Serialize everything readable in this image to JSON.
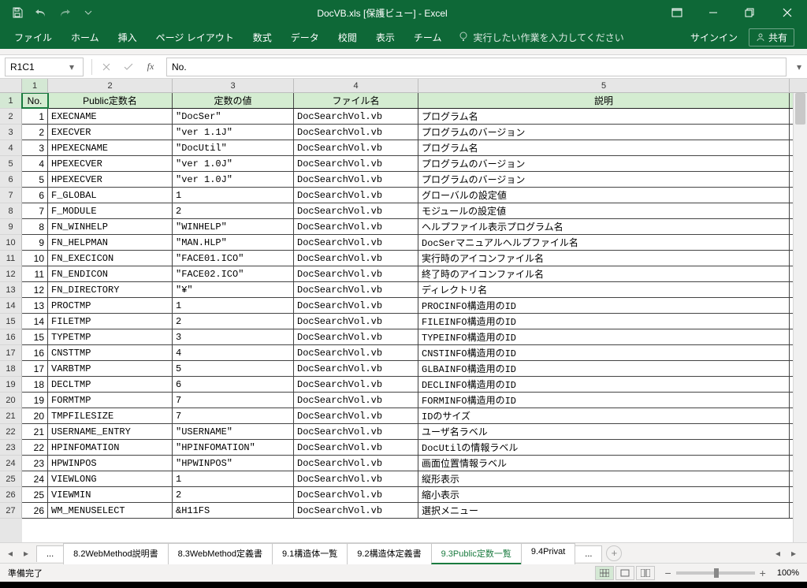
{
  "title": "DocVB.xls  [保護ビュー] - Excel",
  "qat": {
    "save": "保存",
    "undo": "元に戻す",
    "redo": "やり直し",
    "customize": "クイックアクセスツールバーのカスタマイズ"
  },
  "win": {
    "ribbon_opts": "リボン表示オプション",
    "min": "最小化",
    "restore": "元に戻す",
    "close": "閉じる"
  },
  "tabs": [
    "ファイル",
    "ホーム",
    "挿入",
    "ページ レイアウト",
    "数式",
    "データ",
    "校閲",
    "表示",
    "チーム"
  ],
  "tell_me": "実行したい作業を入力してください",
  "signin": "サインイン",
  "share": "共有",
  "name_box": "R1C1",
  "formula_value": "No.",
  "col_numbers": [
    "1",
    "2",
    "3",
    "4",
    "5"
  ],
  "headers": [
    "No.",
    "Public定数名",
    "定数の値",
    "ファイル名",
    "説明"
  ],
  "rows": [
    {
      "no": "1",
      "name": "EXECNAME",
      "val": "\"DocSer\"",
      "file": "DocSearchVol.vb",
      "desc": "プログラム名"
    },
    {
      "no": "2",
      "name": "EXECVER",
      "val": "\"ver 1.1J\"",
      "file": "DocSearchVol.vb",
      "desc": "プログラムのバージョン"
    },
    {
      "no": "3",
      "name": "HPEXECNAME",
      "val": "\"DocUtil\"",
      "file": "DocSearchVol.vb",
      "desc": "プログラム名"
    },
    {
      "no": "4",
      "name": "HPEXECVER",
      "val": "\"ver 1.0J\"",
      "file": "DocSearchVol.vb",
      "desc": "プログラムのバージョン"
    },
    {
      "no": "5",
      "name": "HPEXECVER",
      "val": "\"ver 1.0J\"",
      "file": "DocSearchVol.vb",
      "desc": "プログラムのバージョン"
    },
    {
      "no": "6",
      "name": "F_GLOBAL",
      "val": "1",
      "file": "DocSearchVol.vb",
      "desc": "グローバルの設定値"
    },
    {
      "no": "7",
      "name": "F_MODULE",
      "val": "2",
      "file": "DocSearchVol.vb",
      "desc": "モジュールの設定値"
    },
    {
      "no": "8",
      "name": "FN_WINHELP",
      "val": "\"WINHELP\"",
      "file": "DocSearchVol.vb",
      "desc": "ヘルプファイル表示プログラム名"
    },
    {
      "no": "9",
      "name": "FN_HELPMAN",
      "val": "\"MAN.HLP\"",
      "file": "DocSearchVol.vb",
      "desc": "DocSerマニュアルヘルプファイル名"
    },
    {
      "no": "10",
      "name": "FN_EXECICON",
      "val": "\"FACE01.ICO\"",
      "file": "DocSearchVol.vb",
      "desc": "実行時のアイコンファイル名"
    },
    {
      "no": "11",
      "name": "FN_ENDICON",
      "val": "\"FACE02.ICO\"",
      "file": "DocSearchVol.vb",
      "desc": "終了時のアイコンファイル名"
    },
    {
      "no": "12",
      "name": "FN_DIRECTORY",
      "val": "\"¥\"",
      "file": "DocSearchVol.vb",
      "desc": "ディレクトリ名"
    },
    {
      "no": "13",
      "name": "PROCTMP",
      "val": "1",
      "file": "DocSearchVol.vb",
      "desc": "PROCINFO構造用のID"
    },
    {
      "no": "14",
      "name": "FILETMP",
      "val": "2",
      "file": "DocSearchVol.vb",
      "desc": "FILEINFO構造用のID"
    },
    {
      "no": "15",
      "name": "TYPETMP",
      "val": "3",
      "file": "DocSearchVol.vb",
      "desc": "TYPEINFO構造用のID"
    },
    {
      "no": "16",
      "name": "CNSTTMP",
      "val": "4",
      "file": "DocSearchVol.vb",
      "desc": "CNSTINFO構造用のID"
    },
    {
      "no": "17",
      "name": "VARBTMP",
      "val": "5",
      "file": "DocSearchVol.vb",
      "desc": "GLBAINFO構造用のID"
    },
    {
      "no": "18",
      "name": "DECLTMP",
      "val": "6",
      "file": "DocSearchVol.vb",
      "desc": "DECLINFO構造用のID"
    },
    {
      "no": "19",
      "name": "FORMTMP",
      "val": "7",
      "file": "DocSearchVol.vb",
      "desc": "FORMINFO構造用のID"
    },
    {
      "no": "20",
      "name": "TMPFILESIZE",
      "val": "7",
      "file": "DocSearchVol.vb",
      "desc": "IDのサイズ"
    },
    {
      "no": "21",
      "name": "USERNAME_ENTRY",
      "val": "\"USERNAME\"",
      "file": "DocSearchVol.vb",
      "desc": "ユーザ名ラベル"
    },
    {
      "no": "22",
      "name": "HPINFOMATION",
      "val": "\"HPINFOMATION\"",
      "file": "DocSearchVol.vb",
      "desc": "DocUtilの情報ラベル"
    },
    {
      "no": "23",
      "name": "HPWINPOS",
      "val": "\"HPWINPOS\"",
      "file": "DocSearchVol.vb",
      "desc": "画面位置情報ラベル"
    },
    {
      "no": "24",
      "name": "VIEWLONG",
      "val": "1",
      "file": "DocSearchVol.vb",
      "desc": "縦形表示"
    },
    {
      "no": "25",
      "name": "VIEWMIN",
      "val": "2",
      "file": "DocSearchVol.vb",
      "desc": "縮小表示"
    },
    {
      "no": "26",
      "name": "WM_MENUSELECT",
      "val": "&H11FS",
      "file": "DocSearchVol.vb",
      "desc": "選択メニュー"
    }
  ],
  "sheet_tabs": {
    "ellipsis": "...",
    "list": [
      "8.2WebMethod説明書",
      "8.3WebMethod定義書",
      "9.1構造体一覧",
      "9.2構造体定義書",
      "9.3Public定数一覧",
      "9.4Privat"
    ],
    "active_index": 4,
    "trailing": "..."
  },
  "status": {
    "ready": "準備完了",
    "zoom": "100%"
  }
}
